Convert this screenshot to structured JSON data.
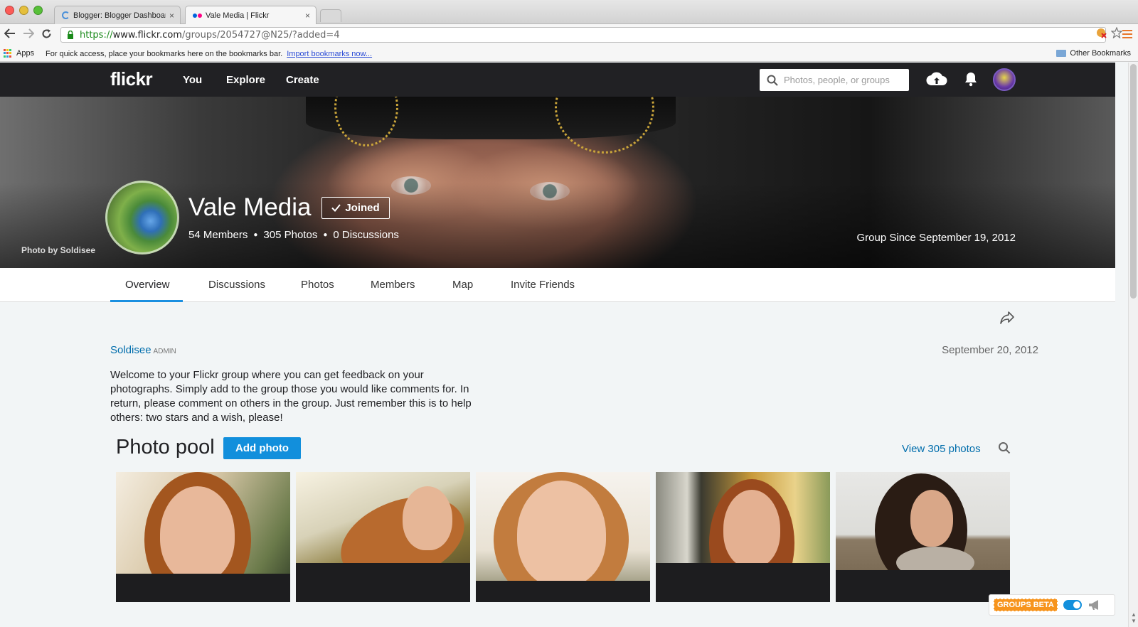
{
  "browser": {
    "tabs": [
      {
        "title": "Blogger: Blogger Dashboar",
        "close": "×"
      },
      {
        "title": "Vale Media | Flickr",
        "close": "×"
      }
    ],
    "url": {
      "scheme": "https://",
      "host": "www.flickr.com",
      "path": "/groups/2054727@N25/?added=4"
    },
    "bookmarks": {
      "apps": "Apps",
      "hint": "For quick access, place your bookmarks here on the bookmarks bar.",
      "import_link": "Import bookmarks now...",
      "other": "Other Bookmarks"
    }
  },
  "header": {
    "logo": "flickr",
    "nav": [
      "You",
      "Explore",
      "Create"
    ],
    "search_placeholder": "Photos, people, or groups"
  },
  "group": {
    "name": "Vale Media",
    "joined_label": "Joined",
    "members": "54 Members",
    "photos": "305 Photos",
    "discussions": "0 Discussions",
    "photo_credit": "Photo by Soldisee",
    "since": "Group Since September 19, 2012"
  },
  "subnav": {
    "tabs": [
      "Overview",
      "Discussions",
      "Photos",
      "Members",
      "Map",
      "Invite Friends"
    ],
    "active": "Overview"
  },
  "post": {
    "author": "Soldisee",
    "role": "ADMIN",
    "date": "September 20, 2012",
    "body": "Welcome to your Flickr group where you can get feedback on your photographs. Simply add to the group those you would like comments for. In return, please comment on others in the group. Just remember this is to help others: two stars and a wish, please!"
  },
  "pool": {
    "title": "Photo pool",
    "add_label": "Add photo",
    "view_label": "View 305 photos"
  },
  "badge": {
    "label": "GROUPS BETA"
  },
  "colors": {
    "brand_blue": "#128fdc",
    "link_blue": "#006dac",
    "header_bg": "#212124",
    "beta_orange": "#f7941d"
  }
}
